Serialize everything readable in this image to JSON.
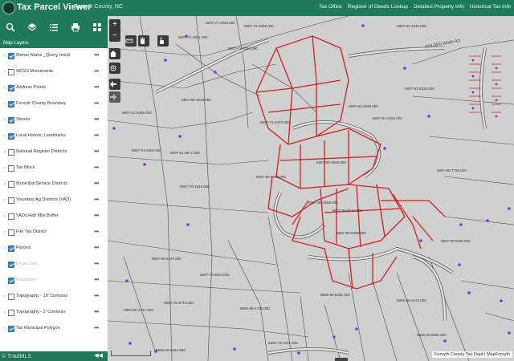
{
  "header": {
    "title": "Tax Parcel Viewer",
    "county": "Forsyth County, NC",
    "links": [
      "Tax Office",
      "Register of Deeds Lookup",
      "Detailed Property Info",
      "Historical Tax Info"
    ]
  },
  "toolbar": {
    "tools": [
      "search-icon",
      "layers-icon",
      "list-icon",
      "print-icon",
      "grid-icon"
    ]
  },
  "layers_panel": {
    "title": "Map Layers",
    "items": [
      {
        "label": "Owner Name _Query result",
        "checked": true,
        "expandable": true,
        "dim": false
      },
      {
        "label": "NCGS Monuments",
        "checked": false,
        "expandable": true,
        "dim": false
      },
      {
        "label": "Address Points",
        "checked": true,
        "expandable": true,
        "dim": false
      },
      {
        "label": "Forsyth County Boundary",
        "checked": true,
        "expandable": true,
        "dim": false
      },
      {
        "label": "Streets",
        "checked": true,
        "expandable": true,
        "dim": false
      },
      {
        "label": "Local Historic Landmarks",
        "checked": true,
        "expandable": true,
        "dim": false
      },
      {
        "label": "National Register Districts",
        "checked": false,
        "expandable": true,
        "dim": false
      },
      {
        "label": "Tax Block",
        "checked": false,
        "expandable": true,
        "dim": false
      },
      {
        "label": "Municipal Service Districts",
        "checked": false,
        "expandable": true,
        "dim": false
      },
      {
        "label": "Voluntary Ag Districts (VAD)",
        "checked": false,
        "expandable": true,
        "dim": false
      },
      {
        "label": "VADs Half Mile Buffer",
        "checked": false,
        "expandable": true,
        "dim": false
      },
      {
        "label": "Fire Tax District",
        "checked": false,
        "expandable": true,
        "dim": false
      },
      {
        "label": "Parcels",
        "checked": true,
        "expandable": true,
        "dim": false
      },
      {
        "label": "Lega Lines",
        "checked": true,
        "expandable": false,
        "dim": true
      },
      {
        "label": "Easement",
        "checked": true,
        "expandable": false,
        "dim": true
      },
      {
        "label": "Topography - 10' Contours",
        "checked": false,
        "expandable": true,
        "dim": false
      },
      {
        "label": "Topography - 2' Contours",
        "checked": false,
        "expandable": true,
        "dim": false
      },
      {
        "label": "Tax Municipal Polygon",
        "checked": true,
        "expandable": true,
        "dim": false
      }
    ],
    "collapse_label": "◀◀"
  },
  "map": {
    "zoom_in": "+",
    "zoom_out": "−",
    "credit": "Forsyth County Tax Dept | MapForsyth",
    "road_label": "GOLDEN WIND RD",
    "parcel_labels": [
      "6807-72-2092.000",
      "6807-71-9939.000",
      "6807-71-3811.000",
      "6807-71-8091.000",
      "6807-80-1640.000",
      "6807-61-5495.000",
      "6807-61-2502.000",
      "6807-61-9672.000",
      "6807-92-1244.000",
      "6807-91-5526.000",
      "6807-81-8308.000",
      "6807-71-8373.000",
      "6807-81-1203.000",
      "6807-80-4509.000",
      "6807-80-4096.000",
      "6807-70-1519.000",
      "6807-90-7796.000",
      "6807-80-3558.000",
      "6807-80-9122.000",
      "6807-80-8388.000",
      "6807-60-8197.000",
      "6807-70-8004.000",
      "6807-90-9290.000",
      "6806-89-8431.000",
      "6806-79-3776.000",
      "6806-89-1706.000",
      "6806-99-3474.000",
      "6806-99-5560.000",
      "6806-79-2311.000",
      "6807-60-4741.000",
      "6806-69-6454.000"
    ]
  },
  "watermark": "© TriadMLS",
  "colors": {
    "header_green": "#1f7a5a",
    "parcel_red": "#d81e1e",
    "map_bg": "#cfd0d0",
    "address_point": "#8e2bd9",
    "checkbox_blue": "#2f7fc1"
  }
}
